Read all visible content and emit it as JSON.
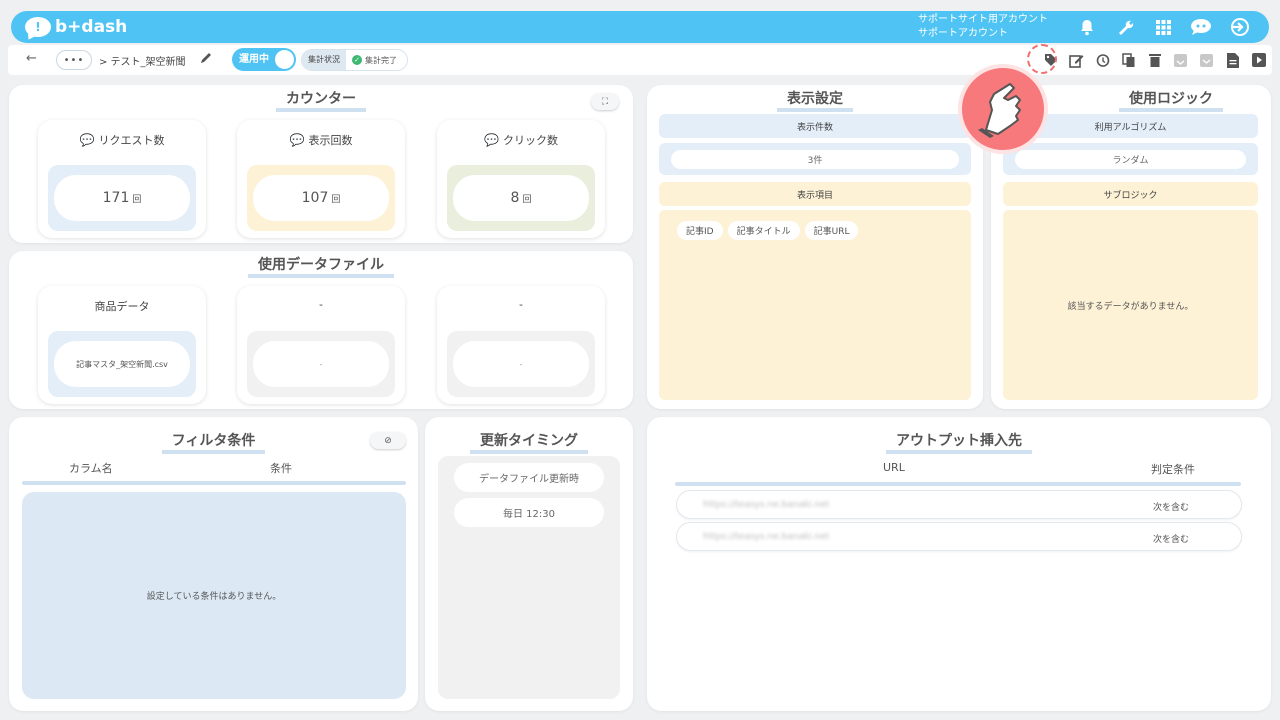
{
  "header": {
    "logo_text": "b+dash",
    "account_line1": "サポートサイト用アカウント",
    "account_line2": "サポートアカウント",
    "icons": [
      "bell-icon",
      "wrench-icon",
      "grid-icon",
      "chat-robot-icon",
      "logout-icon"
    ]
  },
  "subbar": {
    "crumb_dots": "•••",
    "crumb": "> テスト_架空新聞",
    "toggle_label": "運用中",
    "status_label": "集計状況",
    "status_value": "集計完了",
    "toolbar_icons": [
      "tag-icon",
      "edit-icon",
      "history-icon",
      "copy-icon",
      "delete-icon",
      "archive-icon",
      "unarchive-icon",
      "document-icon",
      "play-icon"
    ]
  },
  "counter": {
    "title": "カウンター",
    "items": [
      {
        "label": "リクエスト数",
        "value": "171",
        "unit": "回",
        "color": "#e3eef8"
      },
      {
        "label": "表示回数",
        "value": "107",
        "unit": "回",
        "color": "#fdf1d6"
      },
      {
        "label": "クリック数",
        "value": "8",
        "unit": "回",
        "color": "#eaeedc"
      }
    ]
  },
  "datafile": {
    "title": "使用データファイル",
    "items": [
      {
        "label": "商品データ",
        "value": "記事マスタ_架空新聞.csv"
      },
      {
        "label": "-",
        "value": "-"
      },
      {
        "label": "-",
        "value": "-"
      }
    ]
  },
  "display": {
    "title": "表示設定",
    "count_head": "表示件数",
    "count_value": "3件",
    "items_head": "表示項目",
    "chips": [
      "記事ID",
      "記事タイトル",
      "記事URL"
    ]
  },
  "logic": {
    "title": "使用ロジック",
    "algo_head": "利用アルゴリズム",
    "algo_value": "ランダム",
    "sub_head": "サブロジック",
    "sub_empty": "該当するデータがありません。"
  },
  "filter": {
    "title": "フィルタ条件",
    "col1": "カラム名",
    "col2": "条件",
    "empty": "設定している条件はありません。"
  },
  "timing": {
    "title": "更新タイミング",
    "items": [
      "データファイル更新時",
      "毎日 12:30"
    ]
  },
  "output": {
    "title": "アウトプット挿入先",
    "col1": "URL",
    "col2": "判定条件",
    "rows": [
      {
        "url": "https://teasys.ne.banaki.net",
        "cond": "次を含む"
      },
      {
        "url": "https://teasys.ne.banaki.net",
        "cond": "次を含む"
      }
    ]
  }
}
